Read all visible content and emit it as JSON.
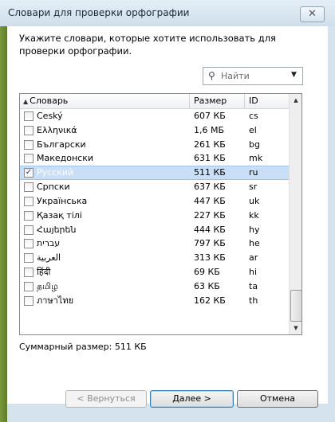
{
  "window": {
    "title": "Словари для проверки орфографии",
    "close_glyph": "✕"
  },
  "instruction": "Укажите словари, которые хотите использовать для проверки орфографии.",
  "search": {
    "placeholder": "Найти",
    "icon": "magnifier-icon"
  },
  "table": {
    "columns": {
      "name": "Словарь",
      "size": "Размер",
      "id": "ID"
    },
    "rows": [
      {
        "name": "Ceský",
        "size": "607 КБ",
        "id": "cs",
        "checked": false
      },
      {
        "name": "Ελληνικά",
        "size": "1,6 МБ",
        "id": "el",
        "checked": false
      },
      {
        "name": "Български",
        "size": "261 КБ",
        "id": "bg",
        "checked": false
      },
      {
        "name": "Македонски",
        "size": "631 КБ",
        "id": "mk",
        "checked": false
      },
      {
        "name": "Русский",
        "size": "511 КБ",
        "id": "ru",
        "checked": true,
        "selected": true
      },
      {
        "name": "Српски",
        "size": "637 КБ",
        "id": "sr",
        "checked": false
      },
      {
        "name": "Українська",
        "size": "447 КБ",
        "id": "uk",
        "checked": false
      },
      {
        "name": "Қазақ тілі",
        "size": "227 КБ",
        "id": "kk",
        "checked": false
      },
      {
        "name": "Հայերեն",
        "size": "444 КБ",
        "id": "hy",
        "checked": false
      },
      {
        "name": "עברית",
        "size": "797 КБ",
        "id": "he",
        "checked": false
      },
      {
        "name": "العربية",
        "size": "313 КБ",
        "id": "ar",
        "checked": false
      },
      {
        "name": "हिंदी",
        "size": "69 КБ",
        "id": "hi",
        "checked": false
      },
      {
        "name": "தமிழ",
        "size": "63 КБ",
        "id": "ta",
        "checked": false
      },
      {
        "name": "ภาษาไทย",
        "size": "162 КБ",
        "id": "th",
        "checked": false
      }
    ]
  },
  "summary": "Суммарный размер: 511 КБ",
  "buttons": {
    "back": "< Вернуться",
    "next": "Далее >",
    "cancel": "Отмена"
  },
  "colors": {
    "selection": "#c9dff7",
    "window_frame": "#d5e3ee",
    "accent_default_button": "#3c7fb1"
  }
}
